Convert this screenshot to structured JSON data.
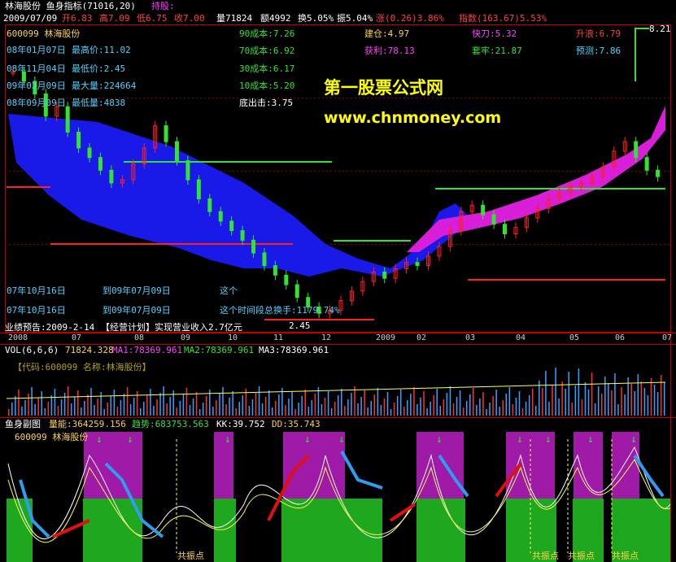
{
  "header": {
    "title": "林海股份 鱼身指标(71016,20)",
    "hold_label": "持股:",
    "hold_value": "持股"
  },
  "quote": {
    "date": "2009/07/09",
    "open": "开6.83",
    "high": "高7.09",
    "low": "低6.75",
    "close": "收7.00",
    "volume": "量71824",
    "amount": "额4992",
    "turnover": "换5.05%",
    "amplitude": "振5.04%",
    "change": "涨(0.26)3.86%",
    "index": "指数(163.67)5.53%"
  },
  "stock": {
    "code_name": "600099 林海股份"
  },
  "left_info": [
    {
      "date": "08年01月07日",
      "label": "最高价:11.02"
    },
    {
      "date": "08年11月04日",
      "label": "最低价:2.45"
    },
    {
      "date": "09年02月09日",
      "label": "最大量:224664"
    },
    {
      "date": "08年09月09日",
      "label": "最低量:4838"
    }
  ],
  "cost": [
    "90成本:7.26",
    "70成本:6.92",
    "30成本:6.17",
    "10成本:5.20"
  ],
  "bottom_out": "底出击:3.75",
  "right_info": {
    "jiancang": "建仓:4.97",
    "kuaidao": "快刀:5.32",
    "shenglang": "升浪:6.79",
    "huoli": "获利:78.13",
    "taolao": "套牢:21.87",
    "yuce": "预测:7.86"
  },
  "watermark": {
    "cn": "第一股票公式网",
    "url": "www.chnmoney.com"
  },
  "period": {
    "row1_from": "07年10月16日",
    "row1_to": "到09年07月09日",
    "row1_note": "这个",
    "row2_from": "07年10月16日",
    "row2_to": "到09年07月09日",
    "row2_note": "这个时间段总换手:1179.74%"
  },
  "forecast": "业绩预告:2009-2-14",
  "plan": "【经营计划】实现营业收入2.7亿元",
  "price_marks": {
    "high": "8.21",
    "low": "2.45"
  },
  "time_axis": [
    "2008",
    "07",
    "08",
    "09",
    "10",
    "11",
    "12",
    "2009",
    "02",
    "03",
    "04",
    "05",
    "06",
    "07"
  ],
  "vol_header": {
    "label": "VOL(6,6,6)",
    "vol": "71824.328",
    "ma1": "MA1:78369.961",
    "ma2": "MA2:78369.961",
    "ma3": "MA3:78369.961"
  },
  "vol_title": "【代码:600099 名称:林海股份】",
  "sub_header": {
    "label": "鱼身副图",
    "energy": "量能:364259.156",
    "trend": "趋势:683753.563",
    "kk": "KK:39.752",
    "dd": "DD:35.743"
  },
  "sub_stock": "600099 林海股份",
  "resonance": "共振点",
  "colors": {
    "up": "#ff2020",
    "down": "#33e233",
    "chip_blue": "#1a1aee",
    "chip_magenta": "#e020e0",
    "axis": "#c00000"
  },
  "chart_data": {
    "type": "candlestick",
    "ylim": [
      2.45,
      8.21
    ],
    "close": [
      10.3,
      10.0,
      9.6,
      8.9,
      9.2,
      8.4,
      7.9,
      7.6,
      7.2,
      6.8,
      6.9,
      7.4,
      7.9,
      8.6,
      8.1,
      7.5,
      6.9,
      6.3,
      5.9,
      5.6,
      5.3,
      5.0,
      4.6,
      4.2,
      3.9,
      3.6,
      3.2,
      2.9,
      2.7,
      2.8,
      3.1,
      3.4,
      3.7,
      4.0,
      3.8,
      4.1,
      4.3,
      4.2,
      4.5,
      4.8,
      5.3,
      5.9,
      6.1,
      5.8,
      5.5,
      5.2,
      5.4,
      5.7,
      6.0,
      6.3,
      6.5,
      6.7,
      6.8,
      7.0,
      7.3,
      7.8,
      8.1,
      7.6,
      7.2,
      7.0
    ]
  }
}
